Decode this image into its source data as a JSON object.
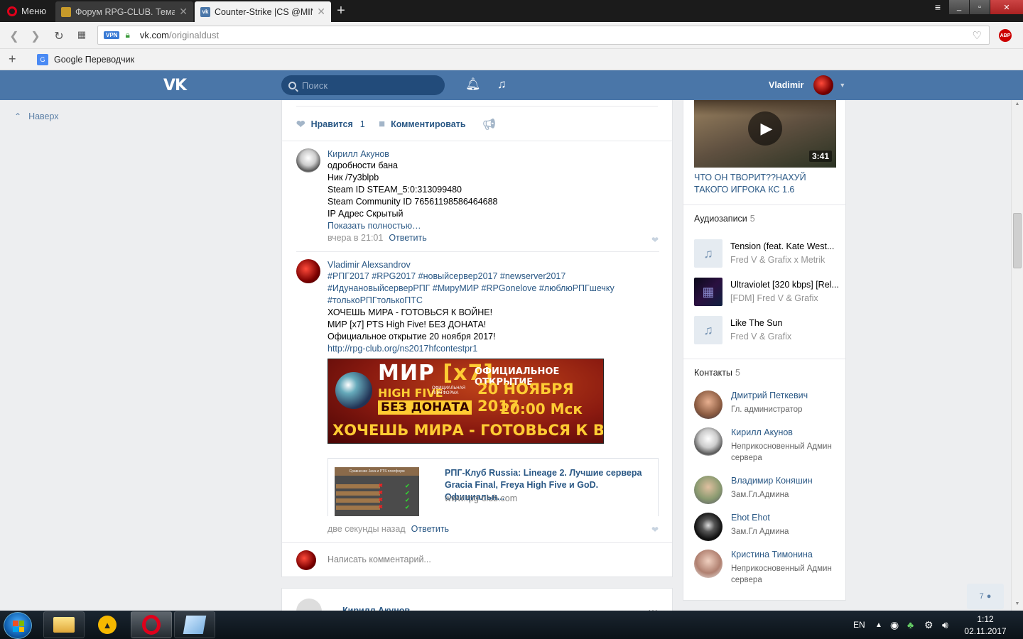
{
  "browser": {
    "menu_label": "Меню",
    "tabs": [
      {
        "title": "Форум RPG-CLUB. Тема: M",
        "active": false
      },
      {
        "title": "Counter-Strike |CS @MINS",
        "active": true
      }
    ],
    "url_host": "vk.com",
    "url_path": "/originaldust",
    "vpn_label": "VPN",
    "abp_label": "ABP",
    "bookmark": "Google Переводчик"
  },
  "vk": {
    "logo": "VK",
    "search_placeholder": "Поиск",
    "user_name": "Vladimir",
    "up_label": "Наверх"
  },
  "post_actions": {
    "like_label": "Нравится",
    "like_count": "1",
    "comment_label": "Комментировать"
  },
  "comments": [
    {
      "author": "Кирилл Акунов",
      "lines": [
        "одробности бана",
        "Ник /7y3blpb",
        "Steam ID STEAM_5:0:313099480",
        "Steam Community ID 76561198586464688",
        "IP Адрес Скрытый"
      ],
      "show_more": "Показать полностью…",
      "time": "вчера в 21:01",
      "reply": "Ответить"
    },
    {
      "author": "Vladimir Alexsandrov",
      "hashtags": [
        "#РПГ2017 #RPG2017 #новыйсервер2017 #newserver2017",
        "#ИдунановыйсерверРПГ #МируМИР #RPGonelove #люблюРПГшечку",
        "#толькоРПГтолькоПТС"
      ],
      "lines": [
        "ХОЧЕШЬ МИРА - ГОТОВЬСЯ К ВОЙНЕ!",
        "МИР [x7] PTS High Five! БЕЗ ДОНАТА!",
        "Официальное открытие 20 ноября 2017!"
      ],
      "link": "http://rpg-club.org/ns2017hfcontestpr1",
      "banner": {
        "title_a": "МИР ",
        "title_b": "[x7]",
        "subtitle": "HIGH FIVE",
        "subtitle_small": "ОФИЦИАЛЬНАЯ ПЛАТФОРМА",
        "no_donate": "БЕЗ ДОНАТА",
        "opening": "ОФИЦИАЛЬНОЕ ОТКРЫТИЕ",
        "date": "20 НОЯБРЯ 2017",
        "time": "20:00 Мск",
        "slogan": "ХОЧЕШЬ МИРА - ГОТОВЬСЯ К ВОЙНЕ"
      },
      "link_card": {
        "title": "РПГ-Клуб Russia: Lineage 2. Лучшие сервера Gracia Final, Freya High Five и GoD. Официальн...",
        "domain": "www.rpg-club.com",
        "thumb_header": "Сравнение Java и PTS платформ"
      },
      "time": "две секунды назад",
      "reply": "Ответить"
    }
  ],
  "write_comment_placeholder": "Написать комментарий...",
  "next_post_author": "Кирилл Акунов",
  "sidebar": {
    "video": {
      "duration": "3:41",
      "title": "ЧТО ОН ТВОРИТ??НАХУЙ ТАКОГО ИГРОКА КС 1.6"
    },
    "audio_title": "Аудиозаписи",
    "audio_count": "5",
    "audio": [
      {
        "title": "Tension (feat. Kate West...",
        "artist": "Fred V & Grafix x Metrik",
        "has_cover": false
      },
      {
        "title": "Ultraviolet [320 kbps] [Rel...",
        "artist": "[FDM] Fred V & Grafix",
        "has_cover": true
      },
      {
        "title": "Like The Sun",
        "artist": "Fred V & Grafix",
        "has_cover": false
      }
    ],
    "contacts_title": "Контакты",
    "contacts_count": "5",
    "contacts": [
      {
        "name": "Дмитрий Петкевич",
        "role": "Гл. администратор"
      },
      {
        "name": "Кирилл Акунов",
        "role": "Неприкосновенный Админ сервера"
      },
      {
        "name": "Владимир Коняшин",
        "role": "Зам.Гл.Админа"
      },
      {
        "name": "Ehot Ehot",
        "role": "Зам.Гл Админа"
      },
      {
        "name": "Кристина Тимонина",
        "role": "Неприкосновенный Админ сервера"
      }
    ]
  },
  "friends_online": "7",
  "taskbar": {
    "lang": "EN",
    "time": "1:12",
    "date": "02.11.2017"
  },
  "colors": {
    "vk_header": "#4a76a8",
    "link": "#2a5885",
    "page_bg": "#edeef0"
  }
}
